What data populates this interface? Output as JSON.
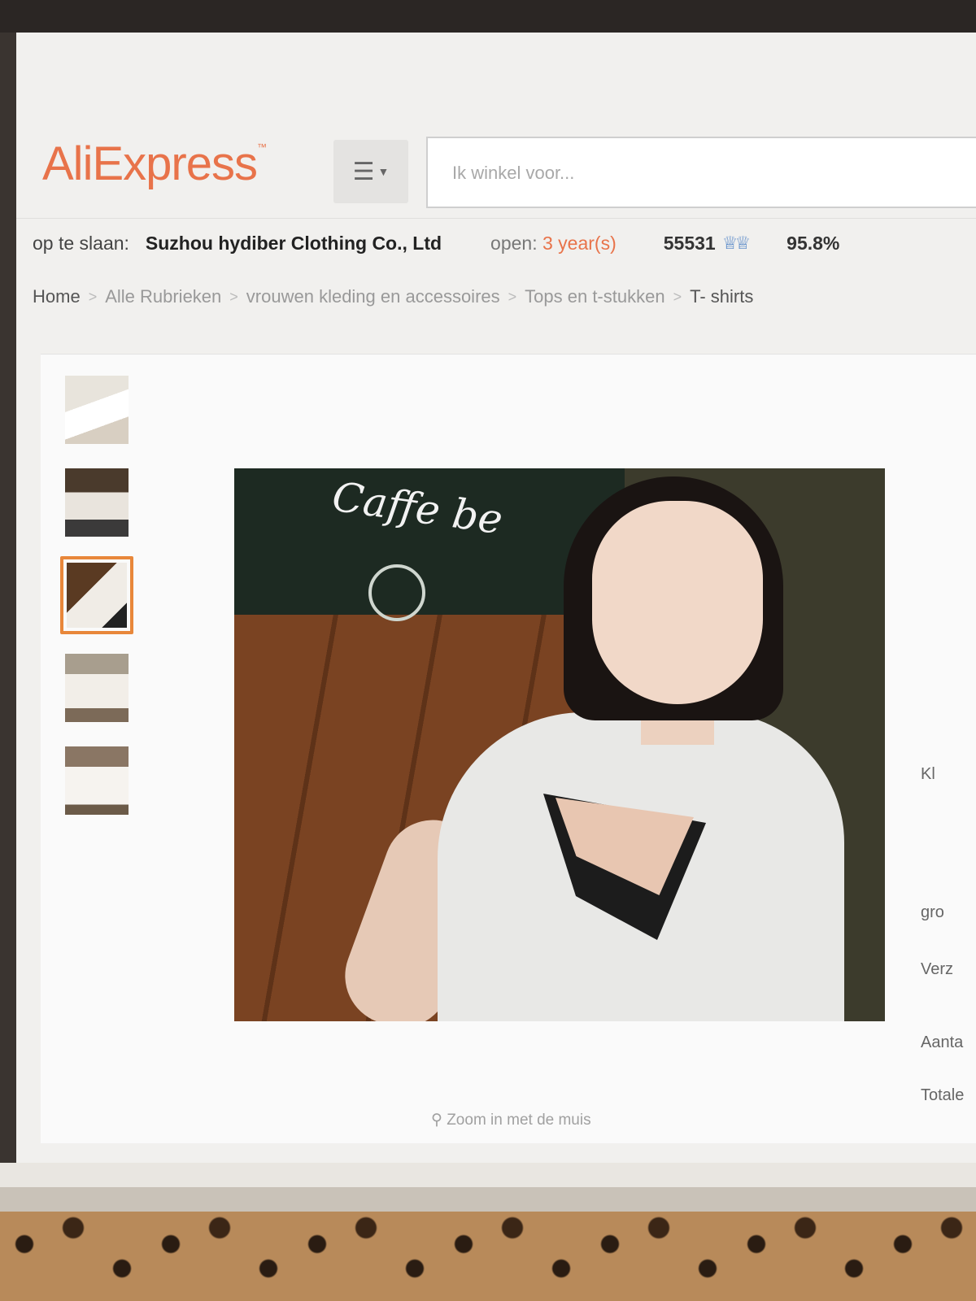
{
  "header": {
    "logo": "AliExpress",
    "logo_tm": "™",
    "category_icon": "menu-icon",
    "search_placeholder": "Ik winkel voor..."
  },
  "store": {
    "label": "op te slaan:",
    "name": "Suzhou hydiber Clothing Co., Ltd",
    "open_label": "open:",
    "open_value": "3 year(s)",
    "score": "55531",
    "rating": "95.8%"
  },
  "breadcrumb": [
    "Home",
    "Alle Rubrieken",
    "vrouwen kleding en accessoires",
    "Tops en t-stukken",
    "T- shirts"
  ],
  "gallery": {
    "thumb_count": 5,
    "active_index": 2,
    "sign_text": "Caffe be",
    "zoom_hint": "Zoom in met de muis"
  },
  "side_labels": [
    "Kl",
    "gro",
    "Verz",
    "Aanta",
    "Totale"
  ],
  "colors": {
    "brand": "#e8734a",
    "active_thumb": "#e8873a"
  }
}
